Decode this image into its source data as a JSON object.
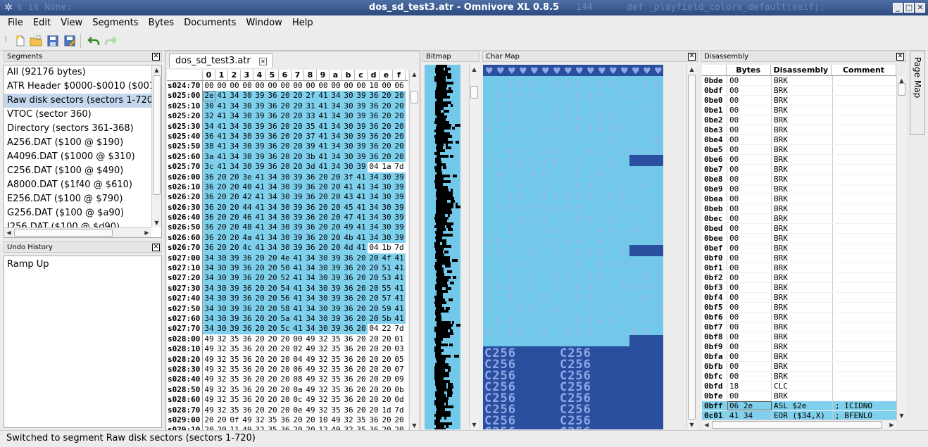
{
  "window": {
    "title": "dos_sd_test3.atr - Omnivore XL 0.8.5",
    "bg_left": "s is None:",
    "bg_num": "144",
    "bg_right": "def _playfield_colors_default(self):"
  },
  "menu": [
    "File",
    "Edit",
    "View",
    "Segments",
    "Bytes",
    "Documents",
    "Window",
    "Help"
  ],
  "toolbar": {
    "icons": [
      "new-file-icon",
      "open-folder-icon",
      "save-icon",
      "save-as-icon",
      "undo-icon",
      "redo-icon"
    ]
  },
  "segments": {
    "title": "Segments",
    "items": [
      "All (92176 bytes)",
      "ATR Header $0000-$0010 ($001",
      "Raw disk sectors (sectors 1-720",
      "VTOC (sector 360)",
      "Directory (sectors 361-368)",
      "A256.DAT ($100 @ $190)",
      "A4096.DAT ($1000 @ $310)",
      "C256.DAT ($100 @ $490)",
      "A8000.DAT ($1f40 @ $610)",
      "E256.DAT ($100 @ $790)",
      "G256.DAT ($100 @ $a90)",
      "I256.DAT ($100 @ $d90)"
    ],
    "selected": 2
  },
  "undo": {
    "title": "Undo History",
    "items": [
      "Ramp Up"
    ]
  },
  "editor": {
    "tab": "dos_sd_test3.atr",
    "cols": [
      "0",
      "1",
      "2",
      "3",
      "4",
      "5",
      "6",
      "7",
      "8",
      "9",
      "a",
      "b",
      "c",
      "d",
      "e",
      "f"
    ],
    "rows": [
      {
        "a": "s024:70",
        "b": "00 00 00 00 00 00 00 00 00 00 00 00 00 18 00 06",
        "h": 0
      },
      {
        "a": "s025:00",
        "b": "2e 41 34 30 39 36 20 20 2f 41 34 30 39 36 20 20",
        "h": 16
      },
      {
        "a": "s025:10",
        "b": "30 41 34 30 39 36 20 20 31 41 34 30 39 36 20 20",
        "h": 16
      },
      {
        "a": "s025:20",
        "b": "32 41 34 30 39 36 20 20 33 41 34 30 39 36 20 20",
        "h": 16
      },
      {
        "a": "s025:30",
        "b": "34 41 34 30 39 36 20 20 35 41 34 30 39 36 20 20",
        "h": 16
      },
      {
        "a": "s025:40",
        "b": "36 41 34 30 39 36 20 20 37 41 34 30 39 36 20 20",
        "h": 16
      },
      {
        "a": "s025:50",
        "b": "38 41 34 30 39 36 20 20 39 41 34 30 39 36 20 20",
        "h": 16
      },
      {
        "a": "s025:60",
        "b": "3a 41 34 30 39 36 20 20 3b 41 34 30 39 36 20 20",
        "h": 16
      },
      {
        "a": "s025:70",
        "b": "3c 41 34 30 39 36 20 20 3d 41 34 30 39 04 1a 7d",
        "h": 13
      },
      {
        "a": "s026:00",
        "b": "36 20 20 3e 41 34 30 39 36 20 20 3f 41 34 30 39",
        "h": 16
      },
      {
        "a": "s026:10",
        "b": "36 20 20 40 41 34 30 39 36 20 20 41 41 34 30 39",
        "h": 16
      },
      {
        "a": "s026:20",
        "b": "36 20 20 42 41 34 30 39 36 20 20 43 41 34 30 39",
        "h": 16
      },
      {
        "a": "s026:30",
        "b": "36 20 20 44 41 34 30 39 36 20 20 45 41 34 30 39",
        "h": 16
      },
      {
        "a": "s026:40",
        "b": "36 20 20 46 41 34 30 39 36 20 20 47 41 34 30 39",
        "h": 16
      },
      {
        "a": "s026:50",
        "b": "36 20 20 48 41 34 30 39 36 20 20 49 41 34 30 39",
        "h": 16
      },
      {
        "a": "s026:60",
        "b": "36 20 20 4a 41 34 30 39 36 20 20 4b 41 34 30 39",
        "h": 16
      },
      {
        "a": "s026:70",
        "b": "36 20 20 4c 41 34 30 39 36 20 20 4d 41 04 1b 7d",
        "h": 13
      },
      {
        "a": "s027:00",
        "b": "34 30 39 36 20 20 4e 41 34 30 39 36 20 20 4f 41",
        "h": 16
      },
      {
        "a": "s027:10",
        "b": "34 30 39 36 20 20 50 41 34 30 39 36 20 20 51 41",
        "h": 16
      },
      {
        "a": "s027:20",
        "b": "34 30 39 36 20 20 52 41 34 30 39 36 20 20 53 41",
        "h": 16
      },
      {
        "a": "s027:30",
        "b": "34 30 39 36 20 20 54 41 34 30 39 36 20 20 55 41",
        "h": 16
      },
      {
        "a": "s027:40",
        "b": "34 30 39 36 20 20 56 41 34 30 39 36 20 20 57 41",
        "h": 16
      },
      {
        "a": "s027:50",
        "b": "34 30 39 36 20 20 58 41 34 30 39 36 20 20 59 41",
        "h": 16
      },
      {
        "a": "s027:60",
        "b": "34 30 39 36 20 20 5a 41 34 30 39 36 20 20 5b 41",
        "h": 16
      },
      {
        "a": "s027:70",
        "b": "34 30 39 36 20 20 5c 41 34 30 39 36 20 04 22 7d",
        "h": 13
      },
      {
        "a": "s028:00",
        "b": "49 32 35 36 20 20 20 00 49 32 35 36 20 20 20 01",
        "h": 0
      },
      {
        "a": "s028:10",
        "b": "49 32 35 36 20 20 20 02 49 32 35 36 20 20 20 03",
        "h": 0
      },
      {
        "a": "s028:20",
        "b": "49 32 35 36 20 20 20 04 49 32 35 36 20 20 20 05",
        "h": 0
      },
      {
        "a": "s028:30",
        "b": "49 32 35 36 20 20 20 06 49 32 35 36 20 20 20 07",
        "h": 0
      },
      {
        "a": "s028:40",
        "b": "49 32 35 36 20 20 20 08 49 32 35 36 20 20 20 09",
        "h": 0
      },
      {
        "a": "s028:50",
        "b": "49 32 35 36 20 20 20 0a 49 32 35 36 20 20 20 0b",
        "h": 0
      },
      {
        "a": "s028:60",
        "b": "49 32 35 36 20 20 20 0c 49 32 35 36 20 20 20 0d",
        "h": 0
      },
      {
        "a": "s028:70",
        "b": "49 32 35 36 20 20 20 0e 49 32 35 36 20 20 1d 7d",
        "h": 0
      },
      {
        "a": "s029:00",
        "b": "20 20 0f 49 32 35 36 20 20 10 49 32 35 36 20 20",
        "h": 0
      },
      {
        "a": "s029:10",
        "b": "20 20 11 49 32 35 36 20 20 12 49 32 35 36 20 20",
        "h": 0
      }
    ]
  },
  "panels": {
    "bitmap": "Bitmap",
    "charmap": "Char Map",
    "disassembly": "Disassembly",
    "pagemap": "Page Map"
  },
  "charmap_text": "C256",
  "disassembly": {
    "headers": [
      "Bytes",
      "Disassembly",
      "Comment"
    ],
    "rows": [
      [
        "0bde",
        "00",
        "BRK",
        ""
      ],
      [
        "0bdf",
        "00",
        "BRK",
        ""
      ],
      [
        "0be0",
        "00",
        "BRK",
        ""
      ],
      [
        "0be1",
        "00",
        "BRK",
        ""
      ],
      [
        "0be2",
        "00",
        "BRK",
        ""
      ],
      [
        "0be3",
        "00",
        "BRK",
        ""
      ],
      [
        "0be4",
        "00",
        "BRK",
        ""
      ],
      [
        "0be5",
        "00",
        "BRK",
        ""
      ],
      [
        "0be6",
        "00",
        "BRK",
        ""
      ],
      [
        "0be7",
        "00",
        "BRK",
        ""
      ],
      [
        "0be8",
        "00",
        "BRK",
        ""
      ],
      [
        "0be9",
        "00",
        "BRK",
        ""
      ],
      [
        "0bea",
        "00",
        "BRK",
        ""
      ],
      [
        "0beb",
        "00",
        "BRK",
        ""
      ],
      [
        "0bec",
        "00",
        "BRK",
        ""
      ],
      [
        "0bed",
        "00",
        "BRK",
        ""
      ],
      [
        "0bee",
        "00",
        "BRK",
        ""
      ],
      [
        "0bef",
        "00",
        "BRK",
        ""
      ],
      [
        "0bf0",
        "00",
        "BRK",
        ""
      ],
      [
        "0bf1",
        "00",
        "BRK",
        ""
      ],
      [
        "0bf2",
        "00",
        "BRK",
        ""
      ],
      [
        "0bf3",
        "00",
        "BRK",
        ""
      ],
      [
        "0bf4",
        "00",
        "BRK",
        ""
      ],
      [
        "0bf5",
        "00",
        "BRK",
        ""
      ],
      [
        "0bf6",
        "00",
        "BRK",
        ""
      ],
      [
        "0bf7",
        "00",
        "BRK",
        ""
      ],
      [
        "0bf8",
        "00",
        "BRK",
        ""
      ],
      [
        "0bf9",
        "00",
        "BRK",
        ""
      ],
      [
        "0bfa",
        "00",
        "BRK",
        ""
      ],
      [
        "0bfb",
        "00",
        "BRK",
        ""
      ],
      [
        "0bfc",
        "00",
        "BRK",
        ""
      ],
      [
        "0bfd",
        "18",
        "CLC",
        ""
      ],
      [
        "0bfe",
        "00",
        "BRK",
        ""
      ],
      [
        "0bff",
        "06 2e",
        "ASL $2e",
        "; ICIDNO"
      ],
      [
        "0c01",
        "41 34",
        "EOR ($34,X)",
        "; BFENLO"
      ]
    ]
  },
  "status": "Switched to segment Raw disk sectors (sectors 1-720)",
  "colors": {
    "highlight": "#7fd0ec",
    "selection": "#c5d7ef",
    "charmap_dark": "#2a4f9e",
    "charmap_light": "#72c8e8"
  }
}
